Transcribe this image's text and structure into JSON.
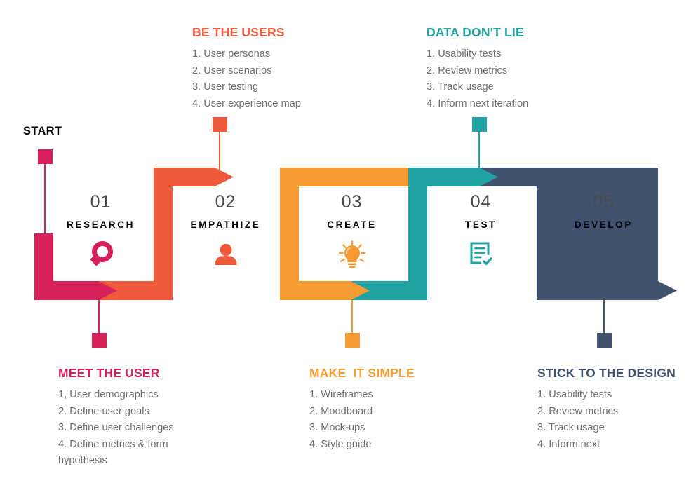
{
  "colors": {
    "pink": "#D6215B",
    "red_orange": "#F05A3C",
    "orange": "#F59B31",
    "teal": "#21A3A3",
    "navy": "#41526E",
    "body_text": "#6e6e6e",
    "number_text": "#4a4a4a",
    "background": "#ffffff"
  },
  "start": {
    "label": "START",
    "color": "#D6215B"
  },
  "steps": [
    {
      "number": "01",
      "name": "RESEARCH",
      "color": "#D6215B",
      "icon": "magnifier-icon"
    },
    {
      "number": "02",
      "name": "EMPATHIZE",
      "color": "#F05A3C",
      "icon": "person-icon"
    },
    {
      "number": "03",
      "name": "CREATE",
      "color": "#F59B31",
      "icon": "lightbulb-icon"
    },
    {
      "number": "04",
      "name": "TEST",
      "color": "#21A3A3",
      "icon": "checklist-icon"
    },
    {
      "number": "05",
      "name": "DEVELOP",
      "color": "#41526E",
      "icon": "bar-chart-icon"
    }
  ],
  "callouts": [
    {
      "id": "be-the-users",
      "title": "BE THE USERS",
      "color": "#F05A3C",
      "position": "top",
      "items": [
        "1. User personas",
        "2. User scenarios",
        "3. User testing",
        "4. User experience map"
      ]
    },
    {
      "id": "data-dont-lie",
      "title": "DATA DON'T LIE",
      "color": "#21A3A3",
      "position": "top",
      "items": [
        "1. Usability tests",
        "2. Review metrics",
        "3. Track usage",
        "4. Inform next iteration"
      ]
    },
    {
      "id": "meet-the-user",
      "title": "MEET THE USER",
      "color": "#D6215B",
      "position": "bottom",
      "items": [
        "1, User demographics",
        "2. Define user goals",
        "3. Define user challenges",
        "4. Define metrics & form\nhypothesis"
      ]
    },
    {
      "id": "make-it-simple",
      "title": "MAKE  IT SIMPLE",
      "color": "#F59B31",
      "position": "bottom",
      "items": [
        "1. Wireframes",
        "2. Moodboard",
        "3. Mock-ups",
        "4. Style guide"
      ]
    },
    {
      "id": "stick-to-the-design",
      "title": "STICK TO THE DESIGN",
      "color": "#41526E",
      "position": "bottom",
      "items": [
        "1. Usability tests",
        "2. Review metrics",
        "3. Track usage",
        "4. Inform next"
      ]
    }
  ]
}
